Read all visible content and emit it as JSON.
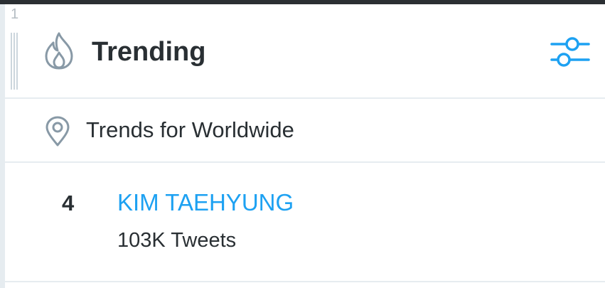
{
  "column": {
    "index": "1"
  },
  "header": {
    "title": "Trending",
    "icon": "flame-icon",
    "settings_icon": "sliders-icon"
  },
  "location": {
    "icon": "location-pin-icon",
    "label": "Trends for Worldwide"
  },
  "trends": [
    {
      "rank": "4",
      "name": "KIM TAEHYUNG",
      "count": "103K Tweets"
    }
  ],
  "colors": {
    "accent": "#1da1f2",
    "text": "#292f33",
    "icon": "#8899a6",
    "divider": "#e6ecf0",
    "top_bar": "#2b2f33"
  }
}
